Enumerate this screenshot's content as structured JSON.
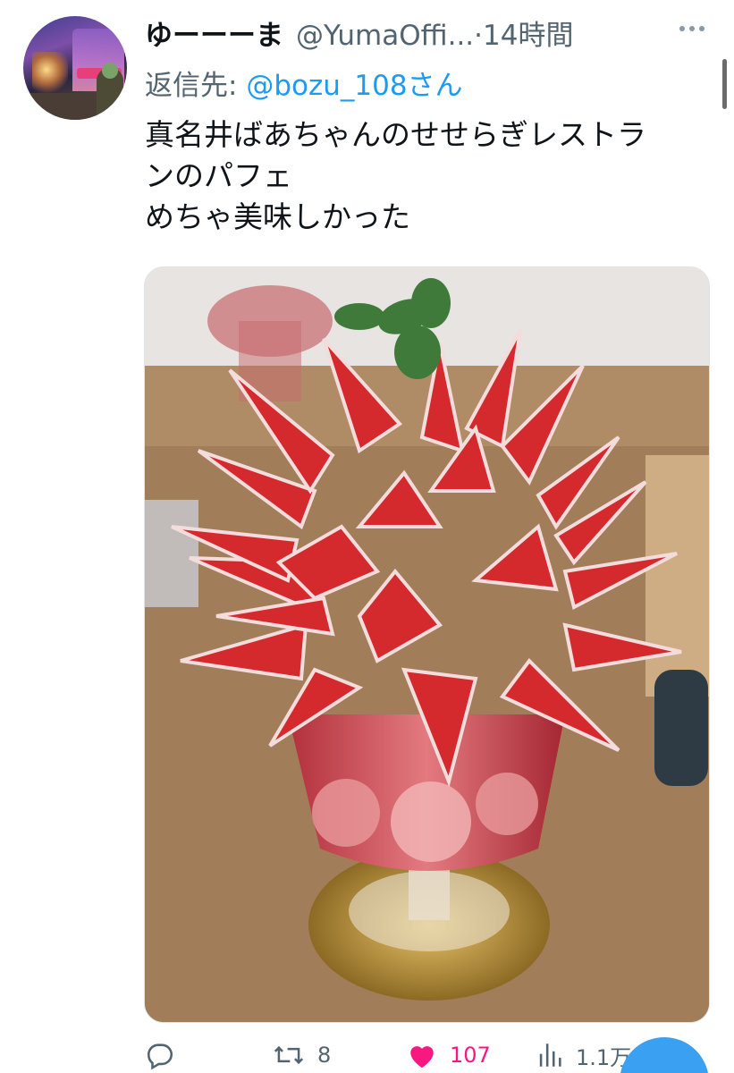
{
  "tweet": {
    "display_name": "ゆーーーま",
    "handle": "@YumaOffi...",
    "separator": "·",
    "time": "14時間",
    "reply": {
      "prefix": "返信先: ",
      "user": "@bozu_108さん"
    },
    "text_lines": [
      "真名井ばあちゃんのせせらぎレストラ",
      "ンのパフェ",
      "めちゃ美味しかった"
    ],
    "photo": {
      "icon": "photo-strawberry-parfait"
    }
  },
  "actions": {
    "reply": {
      "icon": "reply-icon",
      "count": ""
    },
    "retweet": {
      "icon": "retweet-icon",
      "count": "8"
    },
    "like": {
      "icon": "heart-icon",
      "count": "107",
      "color": "#f91880"
    },
    "views": {
      "icon": "views-icon",
      "count": "1.1万"
    }
  },
  "colors": {
    "accent": "#1d9bf0",
    "muted": "#536471",
    "text": "#0f1419"
  }
}
